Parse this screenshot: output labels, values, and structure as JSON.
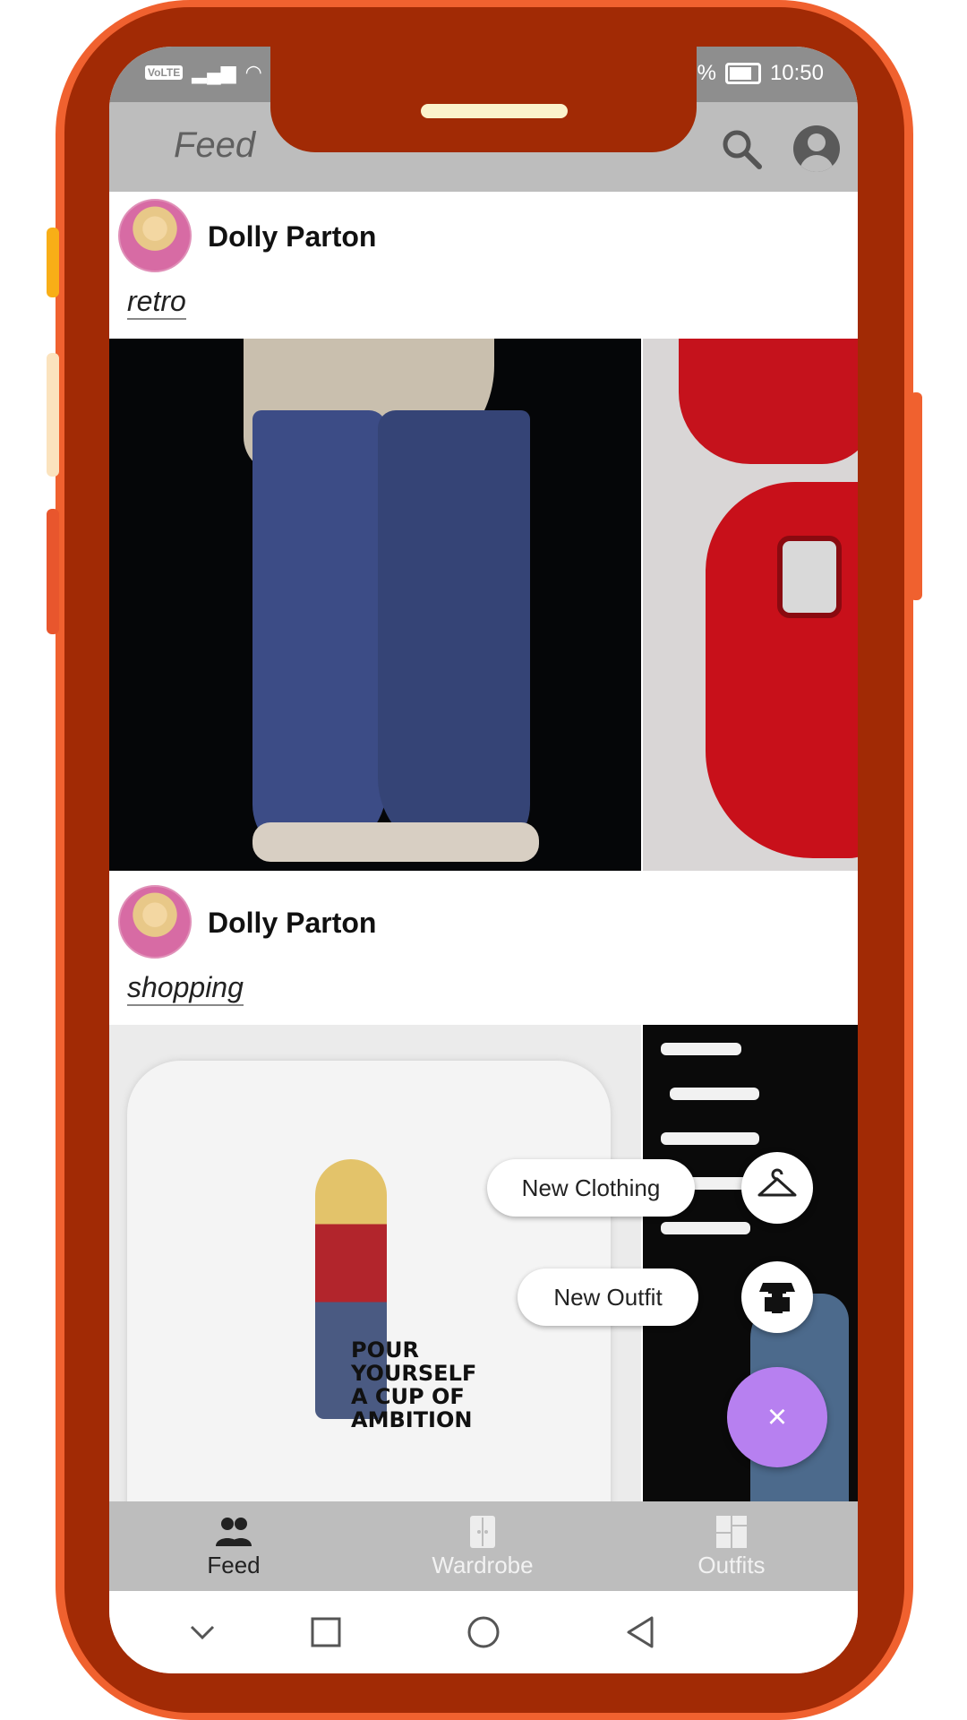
{
  "status_bar": {
    "network_badge": "VoLTE",
    "battery_text": "%",
    "time": "10:50"
  },
  "app_bar": {
    "title": "Feed",
    "search_icon": "search-icon",
    "account_icon": "account-circle-icon"
  },
  "posts": [
    {
      "author": "Dolly Parton",
      "tag": "retro",
      "photos": [
        "embellished-flare-jeans",
        "red-jeweled-heels"
      ]
    },
    {
      "author": "Dolly Parton",
      "tag": "shopping",
      "photos": [
        "dolly-cartoon-tshirt",
        "stage-performance"
      ],
      "shirt_text": [
        "POUR",
        "YOURSELF",
        "A CUP OF",
        "AMBITION"
      ]
    }
  ],
  "fab_menu": {
    "items": [
      {
        "label": "New Clothing",
        "icon": "hanger-icon"
      },
      {
        "label": "New Outfit",
        "icon": "shirt-icon"
      }
    ],
    "close_label": "×"
  },
  "bottom_nav": {
    "items": [
      {
        "label": "Feed",
        "icon": "people-icon",
        "active": true
      },
      {
        "label": "Wardrobe",
        "icon": "wardrobe-icon",
        "active": false
      },
      {
        "label": "Outfits",
        "icon": "outfits-grid-icon",
        "active": false
      }
    ]
  },
  "colors": {
    "frame": "#a12a05",
    "frame_accent": "#f0612f",
    "app_bar": "#bdbdbd",
    "fab": "#b780f0"
  }
}
